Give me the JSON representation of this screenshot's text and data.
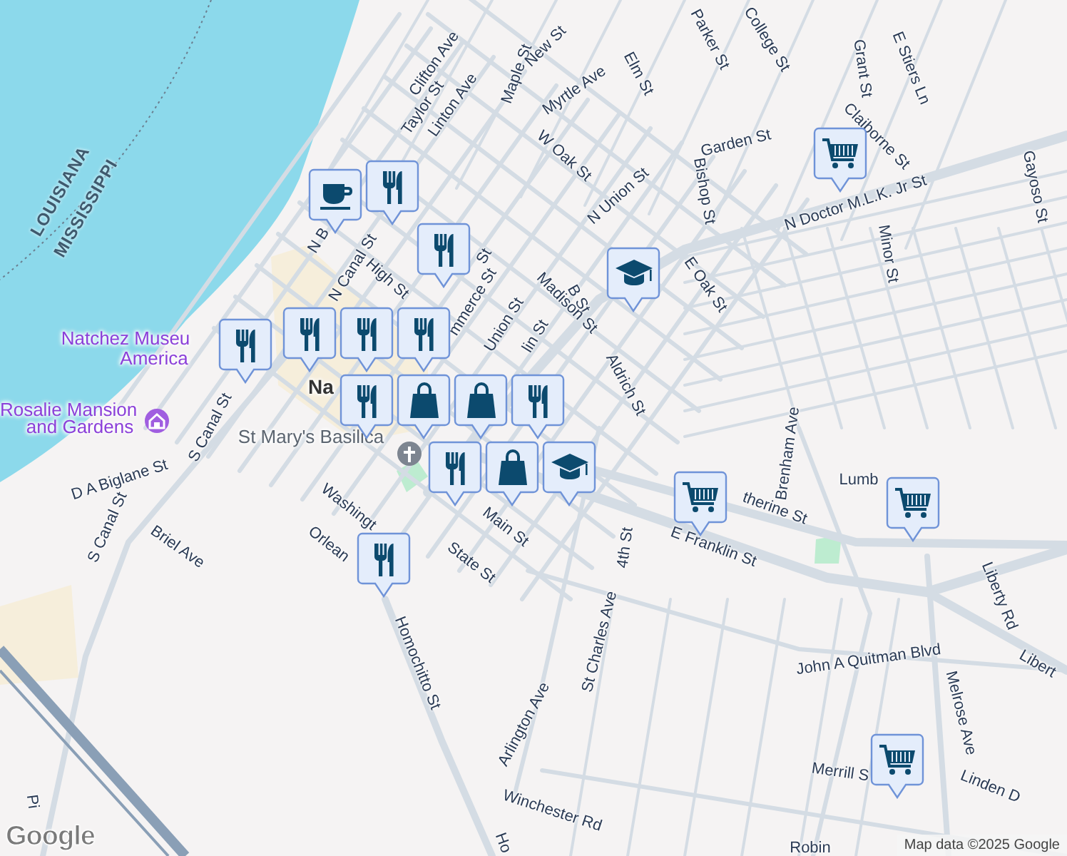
{
  "map": {
    "water_labels": [
      "LOUISIANA",
      "MISSISSIPPI"
    ],
    "place_labels": [
      {
        "text": "Natchez Museu",
        "kind": "museum"
      },
      {
        "text": "America",
        "kind": "museum"
      },
      {
        "text": "Rosalie Mansion",
        "kind": "museum"
      },
      {
        "text": "and Gardens",
        "kind": "museum"
      },
      {
        "text": "St Mary's Basilica",
        "kind": "church"
      },
      {
        "text": "Na",
        "kind": "town"
      }
    ],
    "street_labels": [
      "Clifton Ave",
      "Taylor St",
      "Linton Ave",
      "Maple St",
      "New St",
      "Myrtle Ave",
      "Elm St",
      "Parker St",
      "College St",
      "Grant St",
      "E Stiers Ln",
      "Claiborne St",
      "Garden St",
      "W Oak St",
      "N Union St",
      "Bishop St",
      "N Doctor M.L.K. Jr St",
      "Minor St",
      "Gayoso St",
      "E Oak St",
      "B St",
      "Madison St",
      "Aldrich St",
      "N B",
      "N Canal St",
      "High St",
      "St",
      "mmerce St",
      "Union St",
      "lin St",
      "S Canal St",
      "D A Biglane St",
      "Washingt",
      "Orlean",
      "Main St",
      "State St",
      "Briel Ave",
      "S Canal St",
      "Homochitto St",
      "Arlington Ave",
      "Winchester Rd",
      "Ho",
      "St Charles Ave",
      "4th St",
      "E Franklin St",
      "therine St",
      "Brenham Ave",
      "Lumb",
      "John A Quitman Blvd",
      "Melrose Ave",
      "Liberty Rd",
      "Libert",
      "Merrill S",
      "Linden D",
      "Robin",
      "Pi"
    ],
    "pins": [
      {
        "kind": "cafe"
      },
      {
        "kind": "restaurant"
      },
      {
        "kind": "restaurant"
      },
      {
        "kind": "restaurant"
      },
      {
        "kind": "restaurant"
      },
      {
        "kind": "restaurant"
      },
      {
        "kind": "restaurant"
      },
      {
        "kind": "restaurant"
      },
      {
        "kind": "shopping"
      },
      {
        "kind": "shopping"
      },
      {
        "kind": "restaurant"
      },
      {
        "kind": "restaurant"
      },
      {
        "kind": "shopping"
      },
      {
        "kind": "school"
      },
      {
        "kind": "school"
      },
      {
        "kind": "grocery"
      },
      {
        "kind": "grocery"
      },
      {
        "kind": "grocery"
      },
      {
        "kind": "grocery"
      },
      {
        "kind": "restaurant"
      }
    ],
    "logo": "Google",
    "attribution": "Map data ©2025 Google"
  }
}
